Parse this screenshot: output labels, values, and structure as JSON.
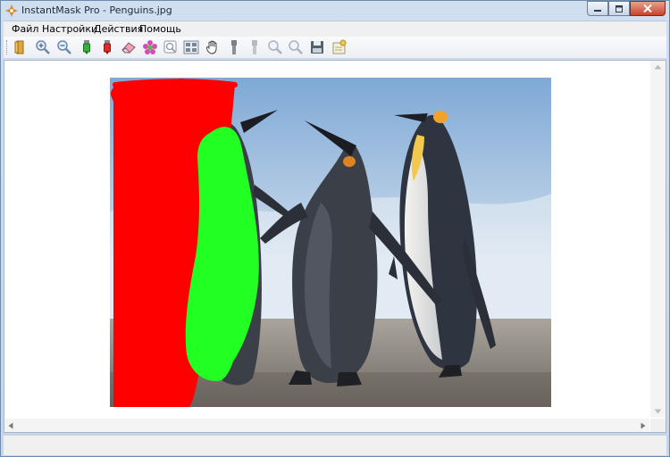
{
  "window": {
    "title": "InstantMask Pro - Penguins.jpg"
  },
  "menu": [
    {
      "label": "Файл"
    },
    {
      "label": "Настройки"
    },
    {
      "label": "Действия"
    },
    {
      "label": "Помощь"
    }
  ],
  "toolbar": {
    "tools": [
      {
        "icon": "open-book-icon"
      },
      {
        "icon": "zoom-in-icon"
      },
      {
        "icon": "zoom-out-icon"
      },
      {
        "icon": "green-marker-icon"
      },
      {
        "icon": "red-marker-icon"
      },
      {
        "icon": "eraser-icon"
      },
      {
        "icon": "flower-icon"
      },
      {
        "icon": "preview-icon"
      },
      {
        "icon": "layout-icon"
      },
      {
        "icon": "hand-icon"
      },
      {
        "icon": "brush-icon"
      },
      {
        "icon": "brush-disabled-icon"
      },
      {
        "icon": "zoom-fit-icon"
      },
      {
        "icon": "zoom-actual-icon"
      },
      {
        "icon": "save-icon"
      },
      {
        "icon": "export-icon"
      }
    ]
  },
  "colors": {
    "foreground_mark": "#22ff22",
    "background_mark": "#ff0000",
    "sky": "#8fb6dc",
    "sand": "#9c958c"
  }
}
